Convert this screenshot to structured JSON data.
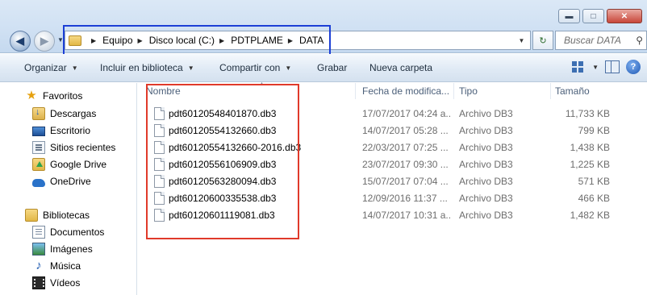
{
  "window": {
    "minimize_label": "▬",
    "maximize_label": "□",
    "close_label": "✕"
  },
  "nav": {
    "back_glyph": "◀",
    "forward_glyph": "▶",
    "history_glyph": "▼"
  },
  "address": {
    "crumbs": [
      "Equipo",
      "Disco local (C:)",
      "PDTPLAME",
      "DATA"
    ],
    "separator": "▶",
    "dropdown_glyph": "▼"
  },
  "refresh": {
    "glyph": "↻"
  },
  "search": {
    "placeholder": "Buscar DATA",
    "icon_glyph": "⚲"
  },
  "toolbar": {
    "organize": "Organizar",
    "include_library": "Incluir en biblioteca",
    "share_with": "Compartir con",
    "burn": "Grabar",
    "new_folder": "Nueva carpeta",
    "caret": "▼",
    "help": "?"
  },
  "sidebar": {
    "favorites_label": "Favoritos",
    "favorites": [
      "Descargas",
      "Escritorio",
      "Sitios recientes",
      "Google Drive",
      "OneDrive"
    ],
    "libraries_label": "Bibliotecas",
    "libraries": [
      "Documentos",
      "Imágenes",
      "Música",
      "Vídeos"
    ]
  },
  "columns": {
    "name": "Nombre",
    "date": "Fecha de modifica...",
    "type": "Tipo",
    "size": "Tamaño",
    "sort_glyph": "▲"
  },
  "files": [
    {
      "name": "pdt60120548401870.db3",
      "date": "17/07/2017 04:24 a...",
      "type": "Archivo DB3",
      "size": "11,733 KB"
    },
    {
      "name": "pdt60120554132660.db3",
      "date": "14/07/2017 05:28 ...",
      "type": "Archivo DB3",
      "size": "799 KB"
    },
    {
      "name": "pdt60120554132660-2016.db3",
      "date": "22/03/2017 07:25 ...",
      "type": "Archivo DB3",
      "size": "1,438 KB"
    },
    {
      "name": "pdt60120556106909.db3",
      "date": "23/07/2017 09:30 ...",
      "type": "Archivo DB3",
      "size": "1,225 KB"
    },
    {
      "name": "pdt60120563280094.db3",
      "date": "15/07/2017 07:04 ...",
      "type": "Archivo DB3",
      "size": "571 KB"
    },
    {
      "name": "pdt60120600335538.db3",
      "date": "12/09/2016 11:37 ...",
      "type": "Archivo DB3",
      "size": "466 KB"
    },
    {
      "name": "pdt60120601119081.db3",
      "date": "14/07/2017 10:31 a...",
      "type": "Archivo DB3",
      "size": "1,482 KB"
    }
  ],
  "colors": {
    "address_highlight": "#1c3fd6",
    "files_highlight": "#e03a2a"
  }
}
